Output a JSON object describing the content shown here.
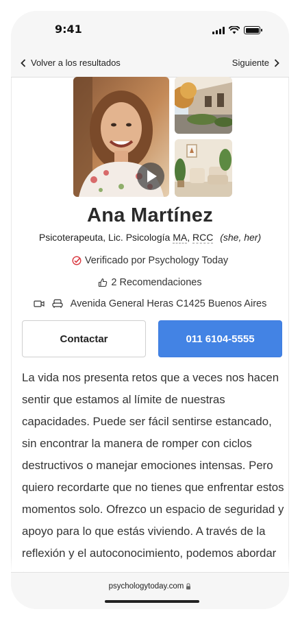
{
  "status_bar": {
    "time": "9:41"
  },
  "nav": {
    "back_label": "Volver a los resultados",
    "next_label": "Siguiente"
  },
  "profile": {
    "name": "Ana Martínez",
    "title": "Psicoterapeuta, Lic. Psicología",
    "credentials": [
      "MA",
      "RCC"
    ],
    "pronouns": "(she, her)",
    "verified": "Verificado por Psychology Today",
    "recommendations": "2 Recomendaciones",
    "address": "Avenida General Heras C1425 Buenos Aires"
  },
  "actions": {
    "contact_label": "Contactar",
    "phone_label": "011 6104-5555"
  },
  "bio": "La vida nos presenta retos que a veces nos hacen sentir que estamos al límite de nuestras capacidades. Puede ser fácil sentirse estancado, sin encontrar la manera de romper con ciclos destructivos o manejar emociones intensas. Pero quiero recordarte que no tienes que enfrentar estos momentos solo. Ofrezco un espacio de seguridad y apoyo para lo que estás viviendo. A través de la reflexión y el autoconocimiento, podemos abordar tus",
  "browser": {
    "url": "psychologytoday.com"
  },
  "colors": {
    "primary_button": "#4383e4",
    "verified_check": "#d9363e"
  },
  "icons": [
    "chevron-left-icon",
    "chevron-right-icon",
    "play-icon",
    "verified-check-icon",
    "thumbs-up-icon",
    "video-icon",
    "in-person-icon",
    "lock-icon"
  ]
}
